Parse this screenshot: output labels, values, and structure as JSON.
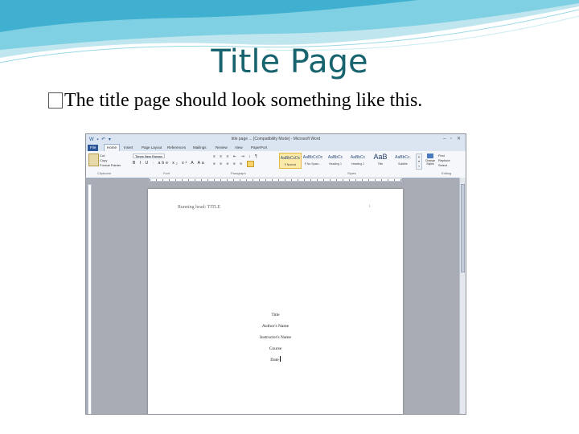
{
  "slide": {
    "title": "Title Page",
    "bullet_glyph": "",
    "bullet_text": "The title page should look something like this."
  },
  "word": {
    "window_title": "title page ... [Compatibility Mode] - Microsoft Word",
    "qat_icons": "W ▪ ↶ ▾",
    "window_buttons": "– ▫ ✕",
    "tabs": [
      "File",
      "Home",
      "Insert",
      "Page Layout",
      "References",
      "Mailings",
      "Review",
      "View",
      "PaperPort"
    ],
    "active_tab": "Home",
    "clipboard": {
      "paste_label": "Paste",
      "items": [
        "Cut",
        "Copy",
        "Format Painter"
      ],
      "group": "Clipboard"
    },
    "font": {
      "name": "Times New Roman",
      "format_buttons": "B I U · abe x₂ x² A Aa",
      "group": "Font"
    },
    "paragraph": {
      "row1": "≡ ≡ ≡ ⇤ ⇥ ↕ ¶",
      "row2": "≡ ≡ ≡ ≡ ≡",
      "group": "Paragraph"
    },
    "styles": {
      "items": [
        {
          "sample": "AaBbCcDc",
          "name": "¶ Normal"
        },
        {
          "sample": "AaBbCcDc",
          "name": "¶ No Spaci..."
        },
        {
          "sample": "AaBbCc",
          "name": "Heading 1"
        },
        {
          "sample": "AaBbCc",
          "name": "Heading 2"
        },
        {
          "sample": "AaB",
          "name": "Title"
        },
        {
          "sample": "AaBbCc.",
          "name": "Subtitle"
        }
      ],
      "group": "Styles",
      "change_styles": "Change Styles"
    },
    "editing": {
      "items": [
        "Find",
        "Replace",
        "Select"
      ],
      "group": "Editing"
    },
    "document": {
      "header": "Running head: TITLE",
      "page_number": "1",
      "title_lines": [
        "Title",
        "Author's Name",
        "Instructor's Name",
        "Course",
        "Date"
      ]
    }
  }
}
